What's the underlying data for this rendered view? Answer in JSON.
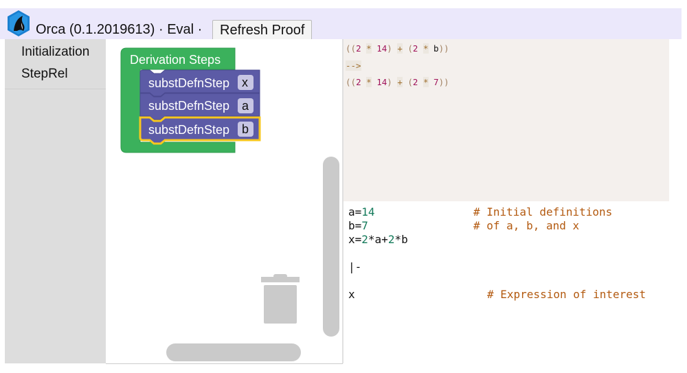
{
  "header": {
    "logo_icon": "orca-logo-icon",
    "app_name": "Orca",
    "version": "(0.1.2019613)",
    "title_text": "Orca (0.1.2019613) · Eval ·",
    "refresh_label": "Refresh Proof"
  },
  "toolbox": {
    "categories": [
      {
        "label": "Initialization"
      },
      {
        "label": "StepRel"
      }
    ]
  },
  "workspace": {
    "container_block": {
      "label": "Derivation Steps",
      "color": "#3bb15c"
    },
    "step_blocks": [
      {
        "label": "substDefnStep",
        "field": "x",
        "selected": false
      },
      {
        "label": "substDefnStep",
        "field": "a",
        "selected": false
      },
      {
        "label": "substDefnStep",
        "field": "b",
        "selected": true
      }
    ],
    "step_color": "#5c5ba6",
    "selected_outline_color": "#f7c71e",
    "trash_icon": "trash-icon"
  },
  "output": {
    "lines": [
      "((2 * 14) + (2 * b))",
      "-->",
      "((2 * 14) + (2 * 7))"
    ]
  },
  "editor": {
    "lines": [
      {
        "code": "a=14",
        "comment": "# Initial definitions"
      },
      {
        "code": "b=7",
        "comment": "# of a, b, and x"
      },
      {
        "code": "x=2*a+2*b",
        "comment": ""
      },
      {
        "code": "",
        "comment": ""
      },
      {
        "code": "|-",
        "comment": ""
      },
      {
        "code": "",
        "comment": ""
      },
      {
        "code": "x",
        "comment": "# Expression of interest"
      }
    ]
  }
}
